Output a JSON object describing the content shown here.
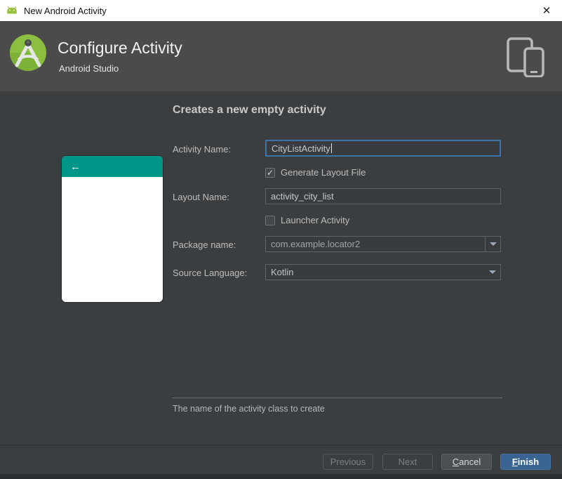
{
  "window": {
    "title": "New Android Activity"
  },
  "icons": {
    "close": "✕",
    "back_arrow": "←",
    "check": "✓"
  },
  "header": {
    "title": "Configure Activity",
    "subtitle": "Android Studio"
  },
  "content": {
    "heading": "Creates a new empty activity",
    "fields": {
      "activity_name": {
        "label": "Activity Name:",
        "value": "CityListActivity"
      },
      "generate_layout": {
        "label": "Generate Layout File",
        "checked": true
      },
      "layout_name": {
        "label": "Layout Name:",
        "value": "activity_city_list"
      },
      "launcher_activity": {
        "label": "Launcher Activity",
        "checked": false
      },
      "package_name": {
        "label": "Package name:",
        "value": "com.example.locator2"
      },
      "source_language": {
        "label": "Source Language:",
        "value": "Kotlin"
      }
    },
    "hint": "The name of the activity class to create"
  },
  "footer": {
    "buttons": {
      "previous": "Previous",
      "next": "Next",
      "cancel": "Cancel",
      "finish": "Finish"
    }
  },
  "colors": {
    "titlebar_bg": "#ffffff",
    "header_bg": "#4b4b4b",
    "panel_bg": "#3b3e40",
    "field_bg": "#393c3e",
    "focus_border": "#3e72a8",
    "finish_button": "#3a6593",
    "preview_teal": "#009688",
    "android_green": "#95c23d"
  }
}
